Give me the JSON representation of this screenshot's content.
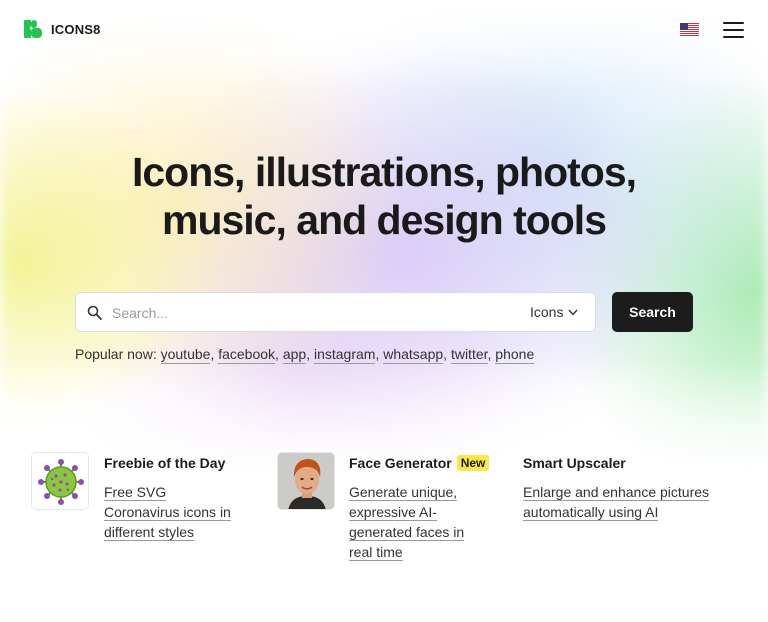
{
  "brand": {
    "name": "ICONS8",
    "accent": "#27c251"
  },
  "header": {
    "language_icon": "us-flag-icon",
    "menu_icon": "hamburger-menu-icon"
  },
  "hero": {
    "title_line1": "Icons, illustrations, photos,",
    "title_line2": "music, and design tools"
  },
  "search": {
    "placeholder": "Search...",
    "type_selected": "Icons",
    "button_label": "Search"
  },
  "popular": {
    "label": "Popular now:",
    "tags": [
      "youtube",
      "facebook",
      "app",
      "instagram",
      "whatsapp",
      "twitter",
      "phone"
    ]
  },
  "cards": [
    {
      "title": "Freebie of the Day",
      "badge": "",
      "description_lines": [
        "Free SVG",
        "Coronavirus icons in",
        "different styles"
      ],
      "thumb": "coronavirus-icon"
    },
    {
      "title": "Face Generator",
      "badge": "New",
      "description_lines": [
        "Generate unique,",
        "expressive AI-",
        "generated faces in",
        "real time"
      ],
      "thumb": "generated-face-photo"
    },
    {
      "title": "Smart Upscaler",
      "badge": "",
      "description_lines": [
        "Enlarge and enhance pictures",
        "automatically using AI"
      ],
      "thumb": ""
    }
  ]
}
